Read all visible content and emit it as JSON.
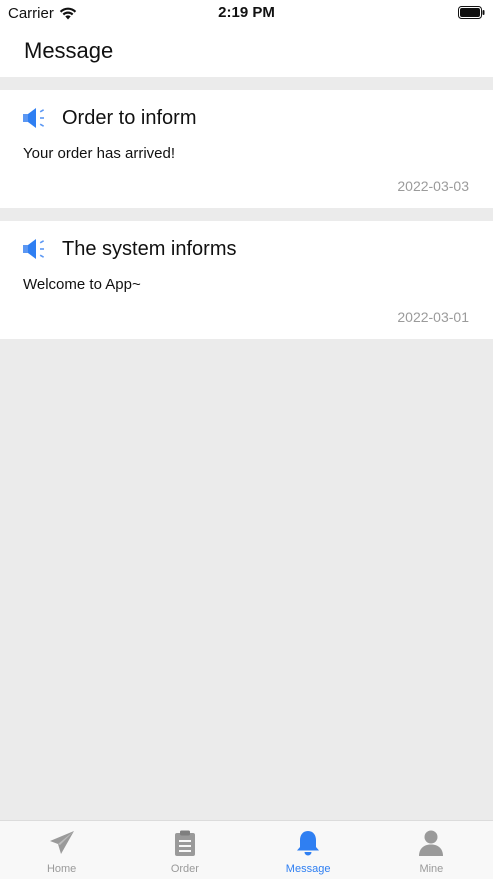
{
  "status_bar": {
    "carrier": "Carrier",
    "time": "2:19 PM"
  },
  "header": {
    "title": "Message"
  },
  "messages": [
    {
      "icon": "speaker-icon",
      "title": "Order to inform",
      "body": "Your order has arrived!",
      "date": "2022-03-03"
    },
    {
      "icon": "speaker-icon",
      "title": "The system informs",
      "body": "Welcome to App~",
      "date": "2022-03-01"
    }
  ],
  "tab_bar": {
    "items": [
      {
        "label": "Home",
        "icon": "paper-plane-icon",
        "active": false
      },
      {
        "label": "Order",
        "icon": "clipboard-icon",
        "active": false
      },
      {
        "label": "Message",
        "icon": "bell-icon",
        "active": true
      },
      {
        "label": "Mine",
        "icon": "person-icon",
        "active": false
      }
    ]
  },
  "colors": {
    "accent": "#2f7ff2",
    "icon_inactive": "#9a9a9a",
    "background": "#ebebeb",
    "date_text": "#9b9b9b"
  }
}
